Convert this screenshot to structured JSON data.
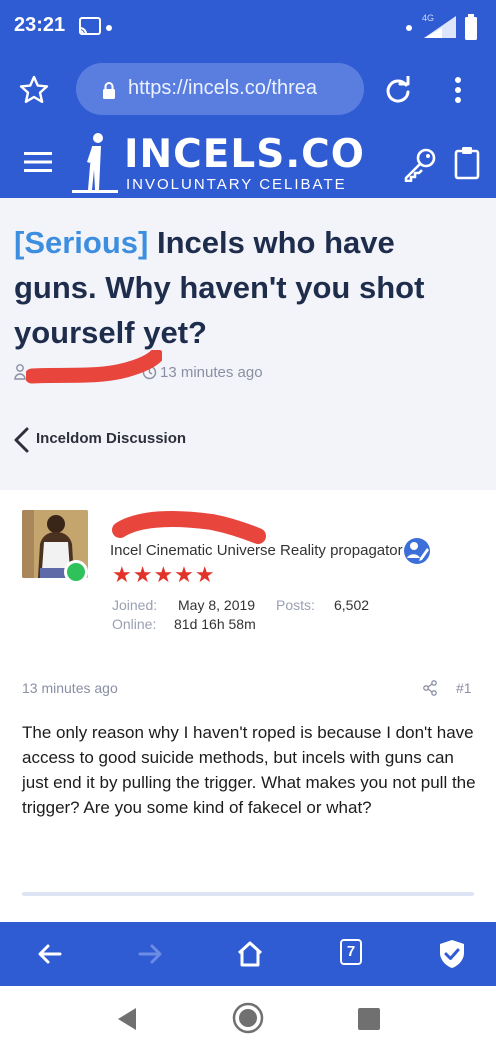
{
  "status_bar": {
    "time": "23:21",
    "network": "4G"
  },
  "browser": {
    "url": "https://incels.co/threa",
    "icons": [
      "star-icon",
      "lock-icon",
      "reload-icon",
      "menu-dots-icon"
    ]
  },
  "site": {
    "logo_title": "INCELS.CO",
    "logo_subtitle": "INVOLUNTARY CELIBATE",
    "icons": [
      "hamburger-icon",
      "key-icon",
      "clipboard-icon"
    ]
  },
  "thread": {
    "prefix": "[Serious]",
    "title": " Incels who have guns. Why haven't you shot yourself yet?",
    "time_ago": "13 minutes ago",
    "breadcrumb": "Inceldom Discussion"
  },
  "post": {
    "user_title": "Incel Cinematic Universe Reality propagator",
    "stars": "★★★★★",
    "joined_label": "Joined:",
    "joined_value": "May 8, 2019",
    "posts_label": "Posts:",
    "posts_value": "6,502",
    "online_label": "Online:",
    "online_value": "81d 16h 58m",
    "date": "13 minutes ago",
    "number": "#1",
    "body": "The only reason why I haven't roped is because I don't have access to good suicide methods, but incels with guns can just end it by pulling the trigger. What makes you not pull the trigger? Are you some kind of fakecel or what?"
  },
  "toolbar": {
    "tab_count": "7",
    "icons": [
      "back-arrow-icon",
      "forward-arrow-icon",
      "home-icon",
      "tabs-icon",
      "shield-check-icon"
    ]
  },
  "colors": {
    "brand_blue": "#2f5bd3",
    "prefix_blue": "#3d8ede",
    "star_red": "#e2332b",
    "online_green": "#30c25a",
    "redaction_red": "#e8453c"
  }
}
